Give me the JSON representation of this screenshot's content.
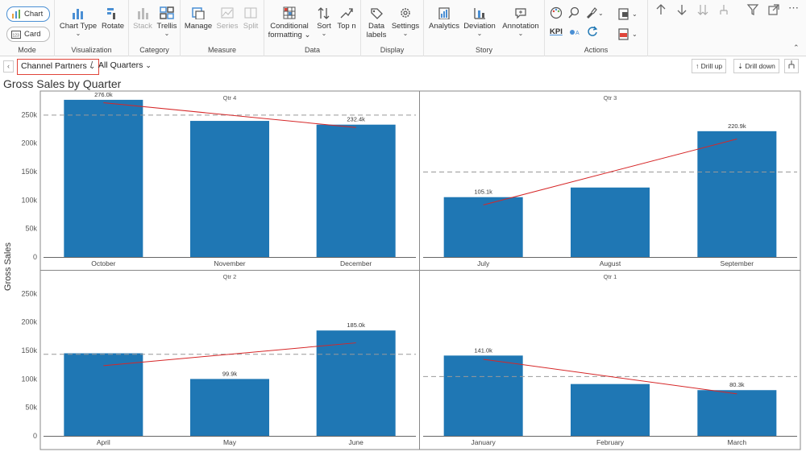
{
  "ribbon": {
    "mode": {
      "label": "Mode",
      "chart": "Chart",
      "card": "Card"
    },
    "visualization": {
      "label": "Visualization",
      "chart_type": "Chart Type",
      "rotate": "Rotate"
    },
    "category": {
      "label": "Category",
      "stack": "Stack",
      "trellis": "Trellis"
    },
    "measure": {
      "label": "Measure",
      "manage": "Manage",
      "series": "Series",
      "split": "Split"
    },
    "data": {
      "label": "Data",
      "conditional_line1": "Conditional",
      "conditional_line2": "formatting",
      "sort": "Sort",
      "top_n": "Top n"
    },
    "display": {
      "label": "Display",
      "data_labels_line1": "Data",
      "data_labels_line2": "labels",
      "settings": "Settings"
    },
    "story": {
      "label": "Story",
      "analytics": "Analytics",
      "deviation": "Deviation",
      "annotation": "Annotation"
    },
    "actions": {
      "label": "Actions",
      "kpi": "KPI"
    }
  },
  "breadcrumb": {
    "selected": "Channel Partners",
    "separator": "/",
    "all": "All Quarters",
    "drill_up": "Drill up",
    "drill_down": "Drill down"
  },
  "title": "Gross Sales by Quarter",
  "y_axis_label": "Gross Sales",
  "colors": {
    "bar": "#1f77b4",
    "trend": "#d62728",
    "avg": "#999999",
    "accent": "#4a8fd4",
    "highlight": "#e0453a"
  },
  "chart_data": {
    "type": "bar",
    "title": "Gross Sales by Quarter",
    "ylabel": "Gross Sales",
    "ylim": [
      0,
      290000
    ],
    "y_ticks": [
      0,
      50000,
      100000,
      150000,
      200000,
      250000
    ],
    "y_tick_labels": [
      "0",
      "50k",
      "100k",
      "150k",
      "200k",
      "250k"
    ],
    "trendline": true,
    "average_line": true,
    "panels": [
      {
        "title": "Qtr 4",
        "categories": [
          "October",
          "November",
          "December"
        ],
        "values": [
          276000,
          239000,
          232400
        ],
        "labels": [
          "276.0k",
          "",
          "232.4k"
        ],
        "average": 249100
      },
      {
        "title": "Qtr 3",
        "categories": [
          "July",
          "August",
          "September"
        ],
        "values": [
          105100,
          122000,
          220900
        ],
        "labels": [
          "105.1k",
          "",
          "220.9k"
        ],
        "average": 149300
      },
      {
        "title": "Qtr 2",
        "categories": [
          "April",
          "May",
          "June"
        ],
        "values": [
          145000,
          99900,
          185000
        ],
        "labels": [
          "",
          "99.9k",
          "185.0k"
        ],
        "average": 143300
      },
      {
        "title": "Qtr 1",
        "categories": [
          "January",
          "February",
          "March"
        ],
        "values": [
          141000,
          91000,
          80300
        ],
        "labels": [
          "141.0k",
          "",
          "80.3k"
        ],
        "average": 104100
      }
    ]
  }
}
